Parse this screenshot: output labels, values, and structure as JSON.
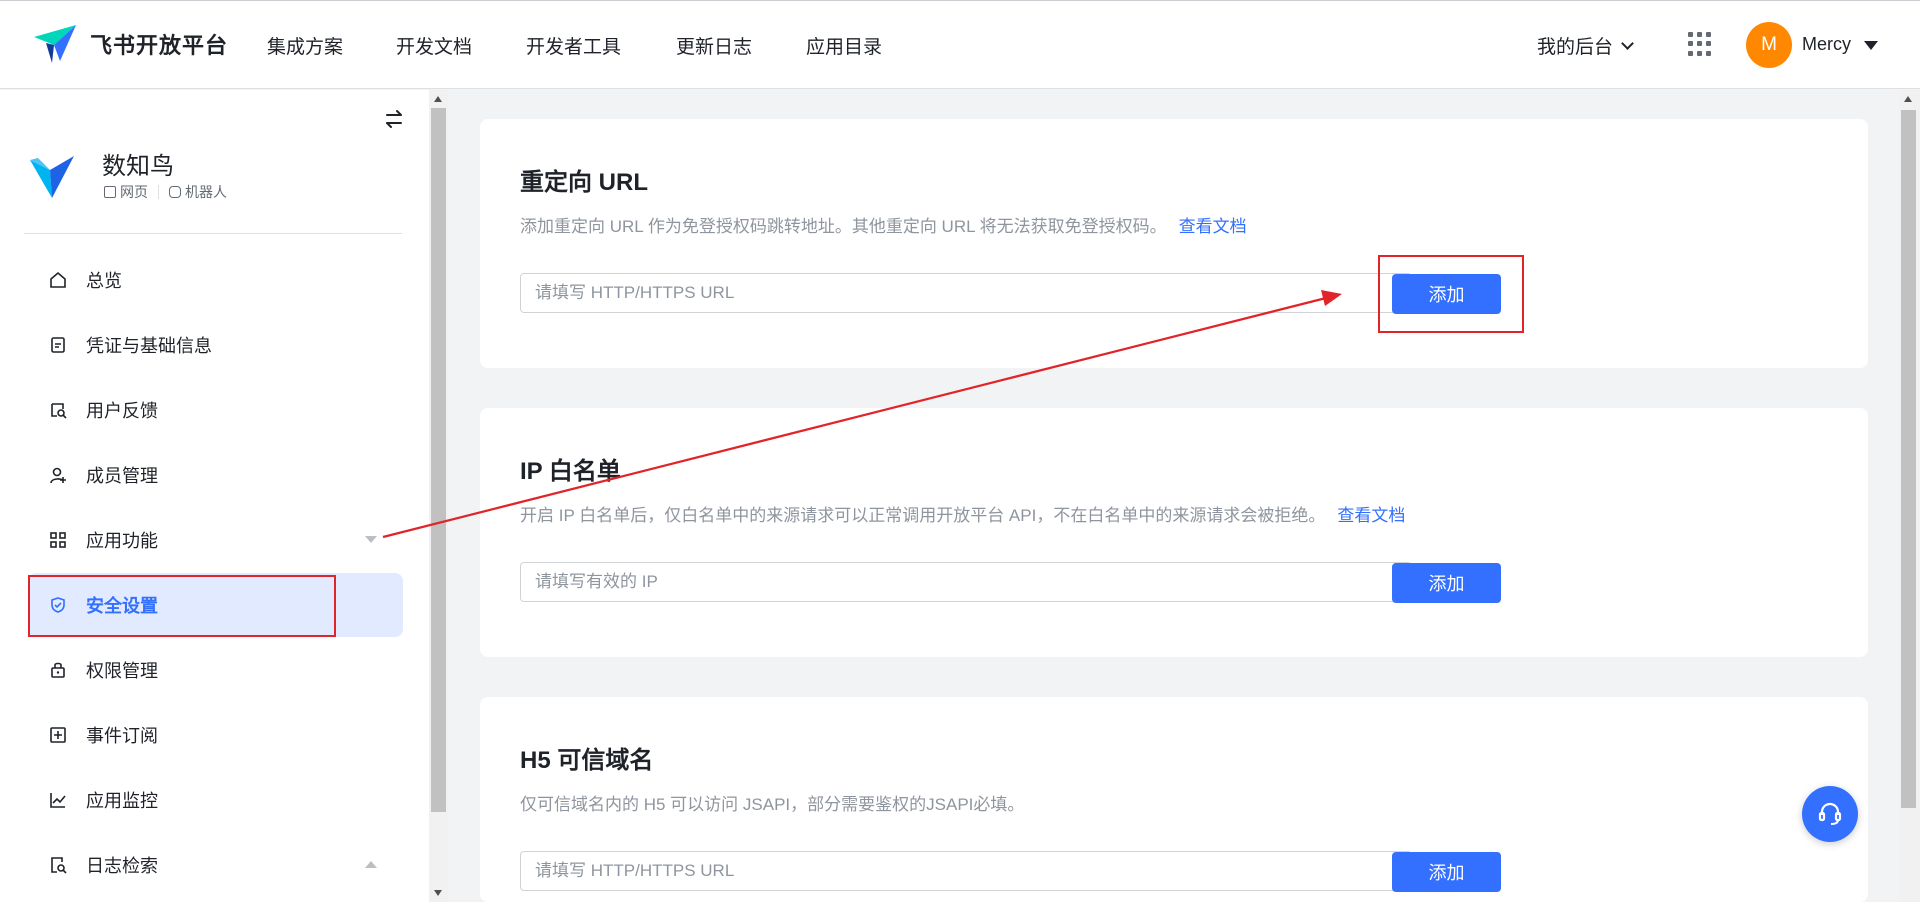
{
  "brand": {
    "name": "飞书开放平台"
  },
  "nav": {
    "items": [
      "集成方案",
      "开发文档",
      "开发者工具",
      "更新日志",
      "应用目录"
    ],
    "console_label": "我的后台",
    "avatar_letter": "M",
    "username": "Mercy"
  },
  "app": {
    "name": "数知鸟",
    "tags": [
      "网页",
      "机器人"
    ]
  },
  "sidebar": {
    "items": [
      {
        "label": "总览",
        "icon": "home-icon"
      },
      {
        "label": "凭证与基础信息",
        "icon": "credential-icon"
      },
      {
        "label": "用户反馈",
        "icon": "feedback-icon"
      },
      {
        "label": "成员管理",
        "icon": "member-icon"
      },
      {
        "label": "应用功能",
        "icon": "apps-icon"
      },
      {
        "label": "安全设置",
        "icon": "shield-icon"
      },
      {
        "label": "权限管理",
        "icon": "lock-icon"
      },
      {
        "label": "事件订阅",
        "icon": "event-icon"
      },
      {
        "label": "应用监控",
        "icon": "chart-icon"
      },
      {
        "label": "日志检索",
        "icon": "log-search-icon"
      }
    ],
    "active_index": 5
  },
  "sections": {
    "redirect": {
      "title": "重定向 URL",
      "desc": "添加重定向 URL 作为免登授权码跳转地址。其他重定向 URL 将无法获取免登授权码。",
      "link": "查看文档",
      "placeholder": "请填写 HTTP/HTTPS URL",
      "button": "添加"
    },
    "ip": {
      "title": "IP 白名单",
      "desc": "开启 IP 白名单后，仅白名单中的来源请求可以正常调用开放平台 API，不在白名单中的来源请求会被拒绝。",
      "link": "查看文档",
      "placeholder": "请填写有效的 IP",
      "button": "添加"
    },
    "h5": {
      "title": "H5 可信域名",
      "desc": "仅可信域名内的 H5 可以访问 JSAPI，部分需要鉴权的JSAPI必填。",
      "placeholder": "请填写 HTTP/HTTPS URL",
      "button": "添加"
    }
  },
  "colors": {
    "accent": "#3370ff",
    "active_bg": "#e1eaff",
    "annotation": "#e0242a",
    "avatar": "#ff8800"
  }
}
